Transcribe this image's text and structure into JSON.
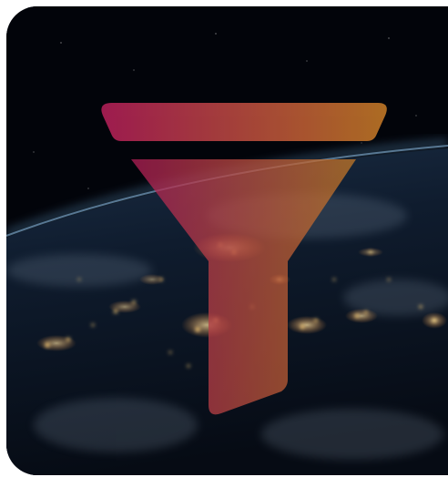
{
  "image": {
    "subject": "earth-at-night-from-orbit",
    "icon": "funnel-icon"
  },
  "colors": {
    "space": "#02040a",
    "ocean_dark": "#0b1626",
    "atmosphere_glow": "#6fa0c8",
    "city_lights": "#ffd27a",
    "funnel_left": "#b21e58",
    "funnel_right": "#c47a26"
  }
}
